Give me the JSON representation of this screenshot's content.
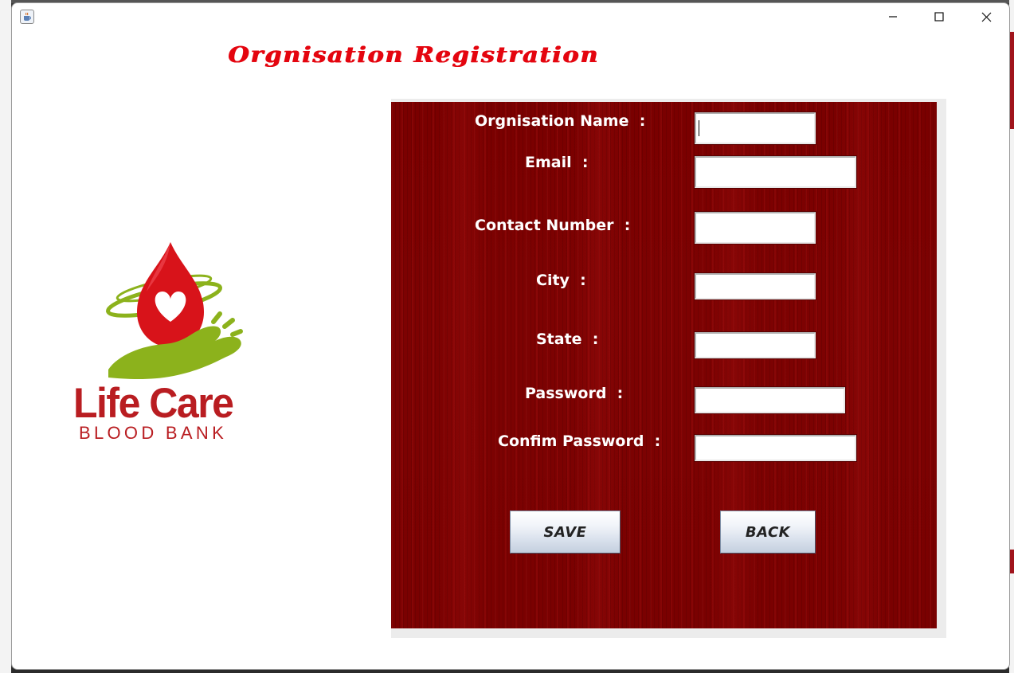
{
  "window": {
    "minimize_icon": "minimize-icon",
    "maximize_icon": "maximize-icon",
    "close_icon": "close-icon",
    "app_icon": "java-cup-icon"
  },
  "page": {
    "title": "Orgnisation Registration",
    "title_color": "#e4050f"
  },
  "logo": {
    "line1": "Life Care",
    "line2": "BLOOD BANK",
    "brand_color": "#b91d21",
    "accent_green": "#8cb21c"
  },
  "form": {
    "panel_color": "#7a0000",
    "fields": [
      {
        "label": "Orgnisation Name  :",
        "value": ""
      },
      {
        "label": "Email  :",
        "value": ""
      },
      {
        "label": "Contact Number  :",
        "value": ""
      },
      {
        "label": "City  :",
        "value": ""
      },
      {
        "label": "State  :",
        "value": ""
      },
      {
        "label": "Password  :",
        "value": ""
      },
      {
        "label": "Confim Password  :",
        "value": ""
      }
    ],
    "save_label": "SAVE",
    "back_label": "BACK"
  }
}
